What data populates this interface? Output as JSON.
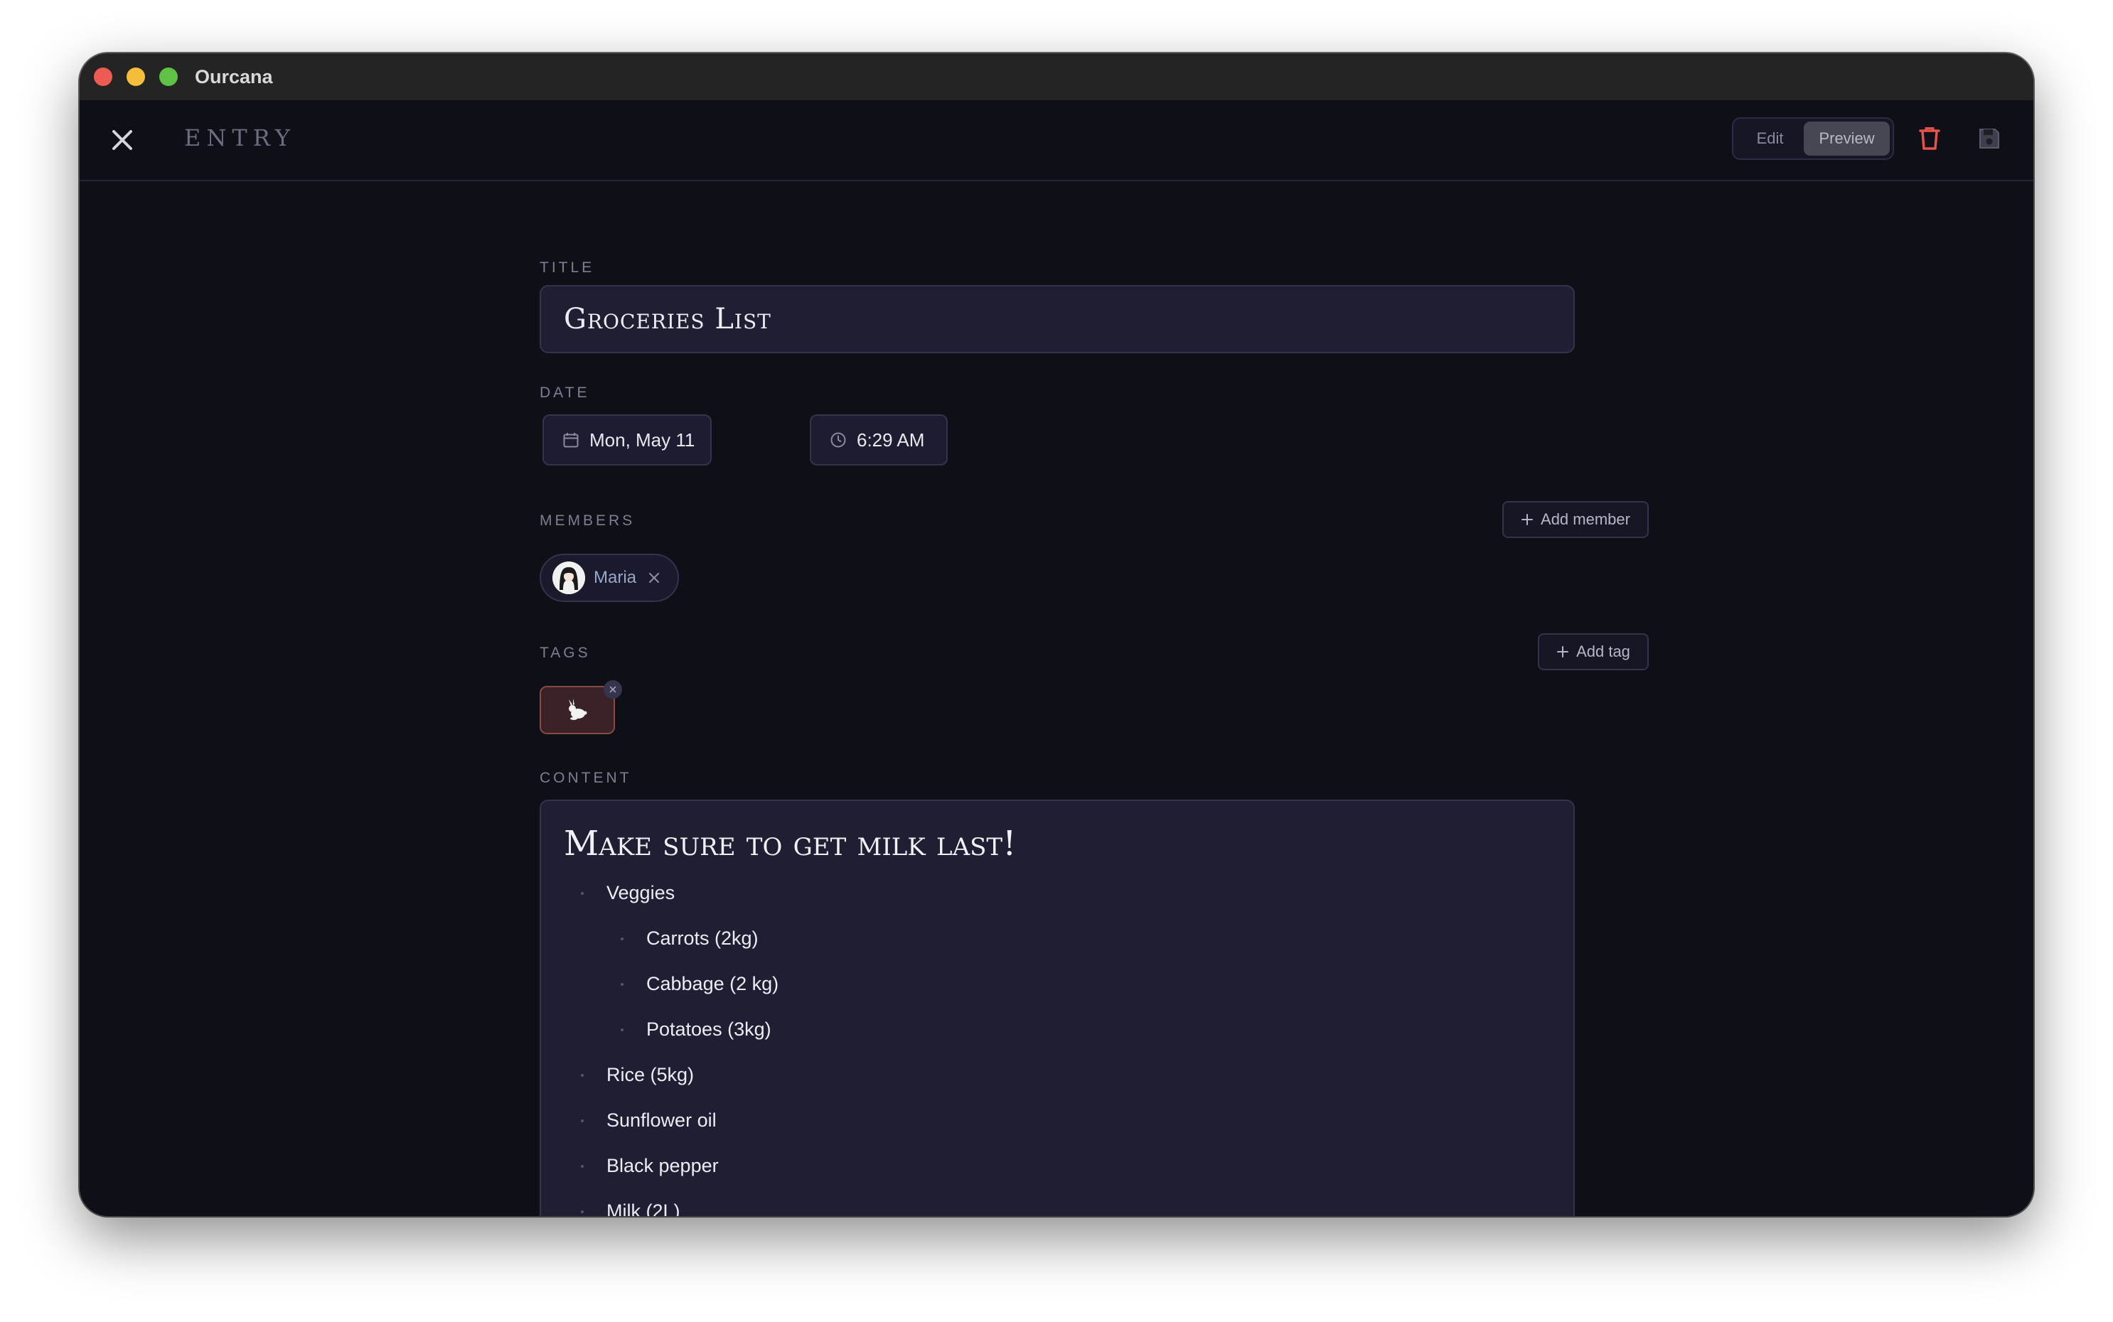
{
  "window": {
    "app_title": "Ourcana"
  },
  "appbar": {
    "entry_label": "ENTRY",
    "mode_edit": "Edit",
    "mode_preview": "Preview",
    "active_mode": "Preview"
  },
  "title_section": {
    "label": "TITLE",
    "value": "Groceries List"
  },
  "date_section": {
    "label": "DATE",
    "date": "Mon, May 11",
    "time": "6:29 AM"
  },
  "members_section": {
    "label": "MEMBERS",
    "add_label": "Add member",
    "members": [
      {
        "name": "Maria"
      }
    ]
  },
  "tags_section": {
    "label": "TAGS",
    "add_label": "Add tag",
    "tags": [
      {
        "icon": "rabbit-icon"
      }
    ]
  },
  "content_section": {
    "label": "CONTENT",
    "heading": "Make sure to get milk last!",
    "items": [
      {
        "text": "Veggies",
        "level": 0
      },
      {
        "text": "Carrots (2kg)",
        "level": 1
      },
      {
        "text": "Cabbage (2 kg)",
        "level": 1
      },
      {
        "text": "Potatoes (3kg)",
        "level": 1
      },
      {
        "text": "Rice (5kg)",
        "level": 0
      },
      {
        "text": "Sunflower oil",
        "level": 0
      },
      {
        "text": "Black pepper",
        "level": 0
      },
      {
        "text": "Milk (2L)",
        "level": 0
      }
    ]
  },
  "colors": {
    "background": "#0f0f17",
    "panel": "#1f1f33",
    "delete_icon": "#e5534b",
    "tag_bg": "#3a2226"
  }
}
